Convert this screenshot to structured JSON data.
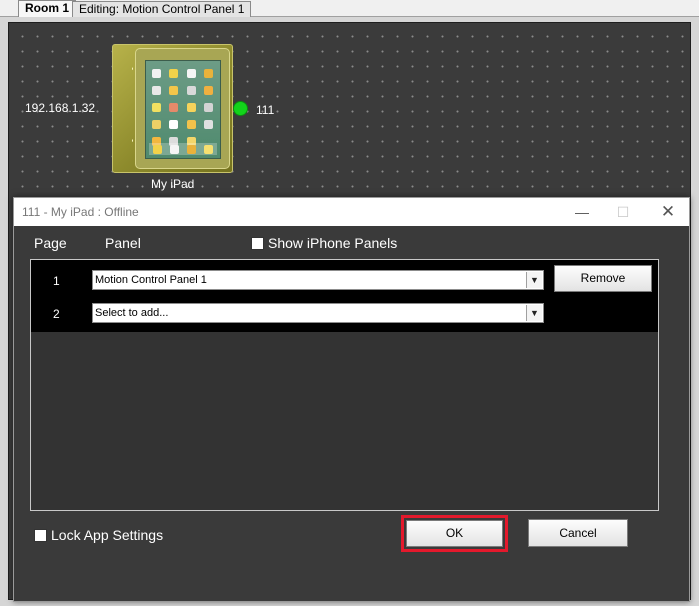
{
  "tabs": [
    {
      "label": "Room 1"
    },
    {
      "label": "Editing: Motion Control Panel 1"
    }
  ],
  "canvas": {
    "ip_address": "192.168.1.32",
    "device_name": "My iPad",
    "device_id": "111",
    "brand": "motioncontrol",
    "status_color": "#12d41a"
  },
  "dialog": {
    "title": "111 - My iPad : Offline",
    "controls": {
      "minimize_icon": "minimize-icon",
      "maximize_icon": "maximize-icon",
      "close_icon": "close-icon"
    },
    "columns": {
      "page": "Page",
      "panel": "Panel"
    },
    "show_iphone_label": "Show iPhone Panels",
    "show_iphone_checked": false,
    "rows": [
      {
        "page": "1",
        "panel": "Motion Control Panel 1"
      },
      {
        "page": "2",
        "panel": "Select to add..."
      }
    ],
    "remove_label": "Remove",
    "lock_label": "Lock App Settings",
    "lock_checked": false,
    "ok_label": "OK",
    "cancel_label": "Cancel",
    "highlight_color": "#e4192c"
  }
}
